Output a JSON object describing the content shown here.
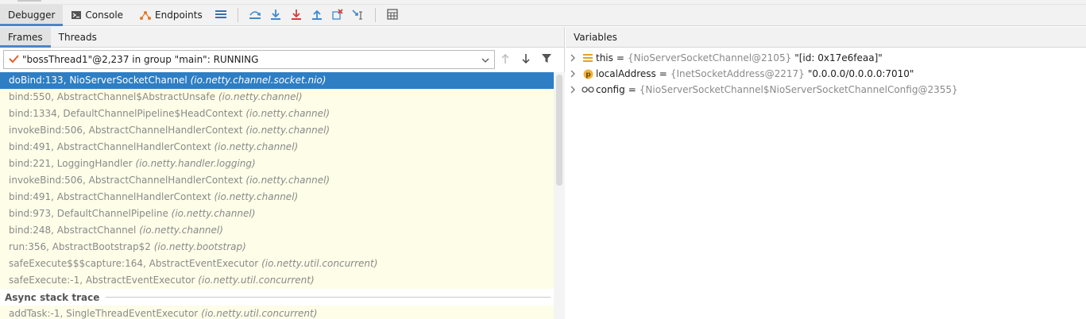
{
  "toolbar": {
    "tabs": [
      {
        "label": "Debugger",
        "active": true
      },
      {
        "label": "Console",
        "active": false
      },
      {
        "label": "Endpoints",
        "active": false
      }
    ],
    "buttons": [
      "hamburger-menu-icon",
      "step-over-icon",
      "step-into-icon",
      "force-step-into-icon",
      "step-out-icon",
      "drop-frame-icon",
      "run-to-cursor-icon",
      "evaluate-expression-icon"
    ]
  },
  "frames_panel": {
    "tabs": [
      {
        "label": "Frames",
        "active": true
      },
      {
        "label": "Threads",
        "active": false
      }
    ],
    "thread_selector": {
      "value": "\"bossThread1\"@2,237 in group \"main\": RUNNING"
    },
    "frames": [
      {
        "method": "doBind:133, NioServerSocketChannel",
        "package": "(io.netty.channel.socket.nio)",
        "selected": true
      },
      {
        "method": "bind:550, AbstractChannel$AbstractUnsafe",
        "package": "(io.netty.channel)",
        "selected": false
      },
      {
        "method": "bind:1334, DefaultChannelPipeline$HeadContext",
        "package": "(io.netty.channel)",
        "selected": false
      },
      {
        "method": "invokeBind:506, AbstractChannelHandlerContext",
        "package": "(io.netty.channel)",
        "selected": false
      },
      {
        "method": "bind:491, AbstractChannelHandlerContext",
        "package": "(io.netty.channel)",
        "selected": false
      },
      {
        "method": "bind:221, LoggingHandler",
        "package": "(io.netty.handler.logging)",
        "selected": false
      },
      {
        "method": "invokeBind:506, AbstractChannelHandlerContext",
        "package": "(io.netty.channel)",
        "selected": false
      },
      {
        "method": "bind:491, AbstractChannelHandlerContext",
        "package": "(io.netty.channel)",
        "selected": false
      },
      {
        "method": "bind:973, DefaultChannelPipeline",
        "package": "(io.netty.channel)",
        "selected": false
      },
      {
        "method": "bind:248, AbstractChannel",
        "package": "(io.netty.channel)",
        "selected": false
      },
      {
        "method": "run:356, AbstractBootstrap$2",
        "package": "(io.netty.bootstrap)",
        "selected": false
      },
      {
        "method": "safeExecute$$$capture:164, AbstractEventExecutor",
        "package": "(io.netty.util.concurrent)",
        "selected": false
      },
      {
        "method": "safeExecute:-1, AbstractEventExecutor",
        "package": "(io.netty.util.concurrent)",
        "selected": false
      }
    ],
    "async_header": "Async stack trace",
    "async_frames": [
      {
        "method": "addTask:-1, SingleThreadEventExecutor",
        "package": "(io.netty.util.concurrent)"
      }
    ]
  },
  "variables_panel": {
    "title": "Variables",
    "items": [
      {
        "icon": "field-list-icon",
        "name": "this",
        "type": "{NioServerSocketChannel@2105}",
        "value": "\"[id: 0x17e6feaa]\""
      },
      {
        "icon": "property-p-icon",
        "name": "localAddress",
        "type": "{InetSocketAddress@2217}",
        "value": "\"0.0.0.0/0.0.0.0:7010\""
      },
      {
        "icon": "watch-glasses-icon",
        "name": "config",
        "type": "{NioServerSocketChannel$NioServerSocketChannelConfig@2355}",
        "value": ""
      }
    ]
  },
  "colors": {
    "accent": "#4a86c7",
    "selected_row": "#2e7ec4",
    "frames_bg": "#fdfde8"
  }
}
